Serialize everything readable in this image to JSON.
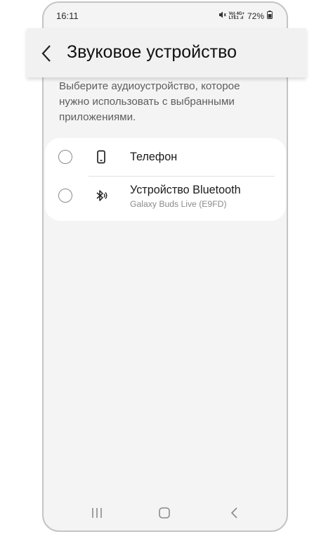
{
  "status_bar": {
    "time": "16:11",
    "network_line1": "Vo) 4G+",
    "network_line2": "LTE1 .ıl",
    "battery": "72%"
  },
  "header": {
    "back_icon": "chevron-left-icon",
    "title": "Звуковое устройство"
  },
  "description": "Выберите аудиоустройство, которое нужно использовать с выбранными приложениями.",
  "devices": [
    {
      "label": "Телефон",
      "subtitle": "",
      "icon": "phone-icon",
      "selected": false
    },
    {
      "label": "Устройство Bluetooth",
      "subtitle": "Galaxy Buds Live (E9FD)",
      "icon": "bluetooth-icon",
      "selected": false
    }
  ],
  "nav_bar": {
    "items": [
      "recent-apps-icon",
      "home-icon",
      "back-icon"
    ]
  }
}
